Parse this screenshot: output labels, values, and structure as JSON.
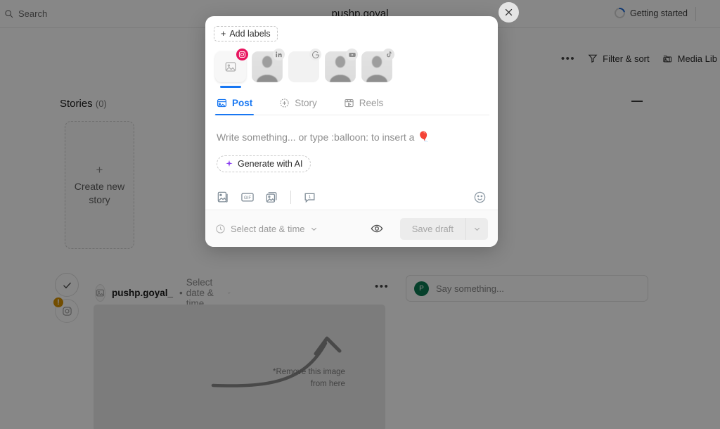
{
  "topbar": {
    "search_placeholder": "Search",
    "title": "pushp.goyal",
    "getting_started": "Getting started"
  },
  "toolbar": {
    "more_label": "•••",
    "filter_sort": "Filter & sort",
    "media_library": "Media Lib"
  },
  "stories": {
    "heading": "Stories",
    "count": "(0)",
    "create_card": {
      "plus": "+",
      "label": "Create\nnew story"
    }
  },
  "post_row": {
    "account_name": "pushp.goyal_",
    "separator": "•",
    "schedule_label": "Select date & time",
    "more_label": "•••",
    "warn_badge": "!",
    "preview_note": "*Remove this image\nfrom here"
  },
  "comment": {
    "avatar_initial": "P",
    "placeholder": "Say something..."
  },
  "modal": {
    "close_label": "✕",
    "add_labels": "Add labels",
    "add_labels_plus": "+",
    "accounts": [
      {
        "name": "instagram-account",
        "network": "instagram",
        "selected": true
      },
      {
        "name": "linkedin-account",
        "network": "linkedin",
        "selected": false
      },
      {
        "name": "google-account",
        "network": "google",
        "selected": false
      },
      {
        "name": "youtube-account",
        "network": "youtube",
        "selected": false
      },
      {
        "name": "tiktok-account",
        "network": "tiktok",
        "selected": false
      }
    ],
    "tabs": [
      {
        "label": "Post",
        "active": true
      },
      {
        "label": "Story",
        "active": false
      },
      {
        "label": "Reels",
        "active": false
      }
    ],
    "composer": {
      "placeholder": "Write something... or type :balloon: to insert a",
      "placeholder_emoji": "🎈",
      "generate_ai": "Generate with AI",
      "comment_count": "1"
    },
    "footer": {
      "date_label": "Select date & time",
      "save_draft": "Save draft"
    }
  },
  "colors": {
    "accent_blue": "#1877f2",
    "instagram_pink": "#e8155f",
    "ai_purple": "#8b3ff0",
    "warning_amber": "#d89100",
    "avatar_green": "#0d7a52"
  }
}
